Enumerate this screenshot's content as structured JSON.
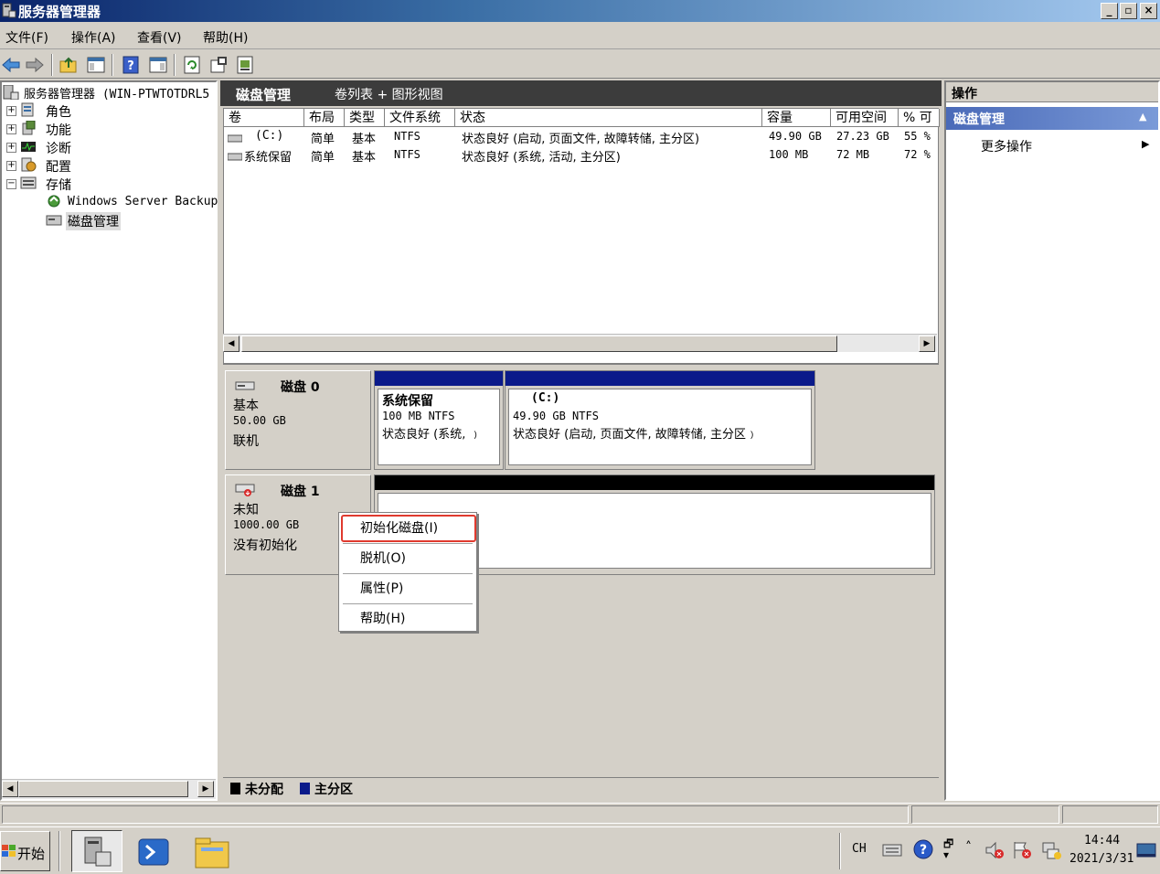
{
  "window": {
    "title": "服务器管理器",
    "btn_min": "_",
    "btn_max": "▫",
    "btn_close": "×"
  },
  "menu": {
    "file": "文件(F)",
    "action": "操作(A)",
    "view": "查看(V)",
    "help": "帮助(H)"
  },
  "tree": {
    "root": "服务器管理器 (WIN-PTWTOTDRL5",
    "roles": "角色",
    "features": "功能",
    "diagnostics": "诊断",
    "config": "配置",
    "storage": "存储",
    "wsb": "Windows Server Backup",
    "diskmgmt": "磁盘管理",
    "expand_plus": "+",
    "expand_minus": "−"
  },
  "center": {
    "title": "磁盘管理",
    "view_label": "卷列表 + 图形视图"
  },
  "table": {
    "columns": [
      "卷",
      "布局",
      "类型",
      "文件系统",
      "状态",
      "容量",
      "可用空间",
      "% 可月"
    ],
    "rows": [
      {
        "vol": "(C:)",
        "layout": "简单",
        "type": "基本",
        "fs": "NTFS",
        "status": "状态良好 (启动, 页面文件, 故障转储, 主分区)",
        "cap": "49.90 GB",
        "free": "27.23 GB",
        "pct": "55 %"
      },
      {
        "vol": "系统保留",
        "layout": "简单",
        "type": "基本",
        "fs": "NTFS",
        "status": "状态良好 (系统, 活动, 主分区)",
        "cap": "100 MB",
        "free": "72 MB",
        "pct": "72 %"
      }
    ]
  },
  "disk0": {
    "name": "磁盘 0",
    "kind": "基本",
    "size": "50.00 GB",
    "state": "联机",
    "p1": {
      "name": "系统保留",
      "info": "100 MB NTFS",
      "status": "状态良好 (系统, ﹚"
    },
    "p2": {
      "name": "(C:)",
      "info": "49.90 GB NTFS",
      "status": "状态良好 (启动, 页面文件, 故障转储, 主分区﹚"
    }
  },
  "disk1": {
    "name": "磁盘 1",
    "kind": "未知",
    "size": "1000.00 GB",
    "state": "没有初始化"
  },
  "legend": {
    "unallocated": "未分配",
    "primary": "主分区"
  },
  "context_menu": {
    "init": "初始化磁盘(I)",
    "offline": "脱机(O)",
    "props": "属性(P)",
    "help": "帮助(H)"
  },
  "actions": {
    "header": "操作",
    "section": "磁盘管理",
    "more": "更多操作"
  },
  "taskbar": {
    "start": "开始",
    "lang": "CH",
    "time": "14:44",
    "date": "2021/3/31"
  },
  "colors": {
    "primary_partition": "#0a1a8a",
    "unallocated": "#000000",
    "highlight": "#e03a2e"
  },
  "icons": [
    "back-arrow-icon",
    "forward-arrow-icon",
    "folder-up-icon",
    "show-hide-icon",
    "help-icon",
    "refresh-icon",
    "properties-icon",
    "export-icon"
  ]
}
